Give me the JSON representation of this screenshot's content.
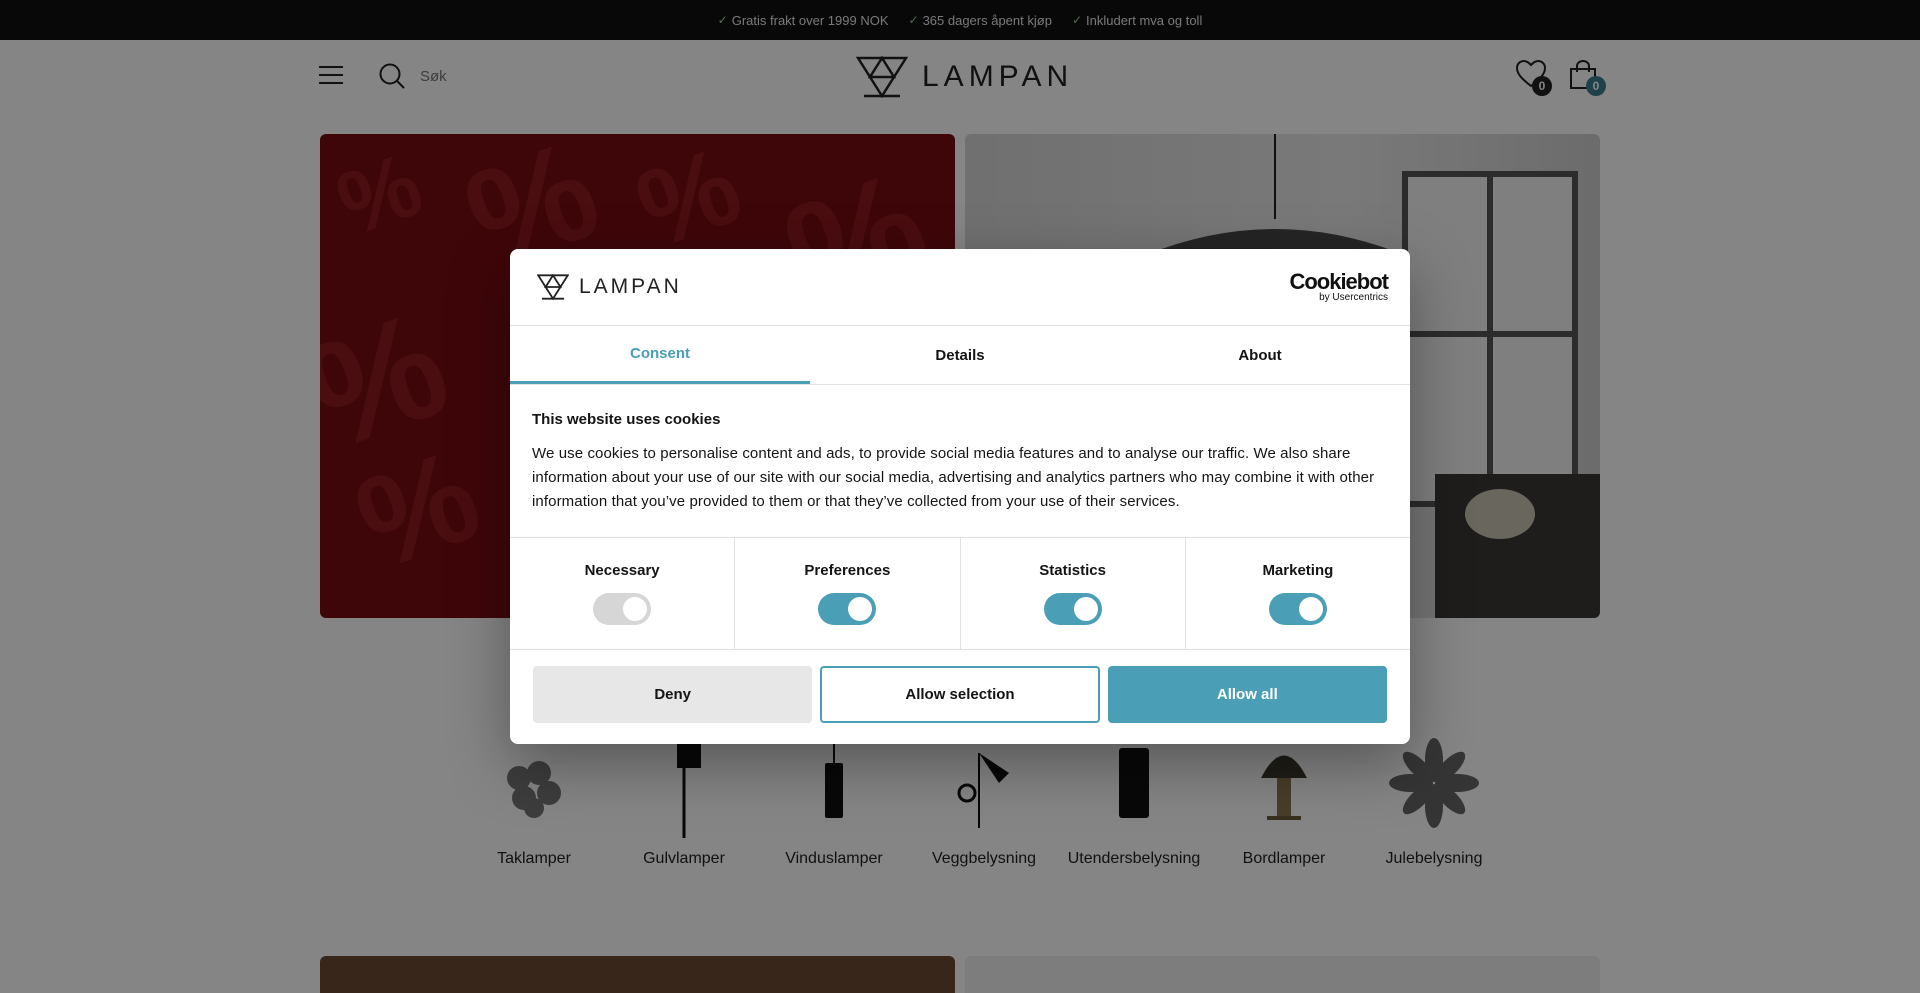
{
  "topbar": {
    "usps": [
      {
        "icon": "check-icon",
        "text": "Gratis frakt over 1999 NOK"
      },
      {
        "icon": "check-icon",
        "text": "365 dagers åpent kjøp"
      },
      {
        "icon": "check-icon",
        "text": "Inkludert mva og toll"
      }
    ]
  },
  "header": {
    "search_placeholder": "Søk",
    "logo_text": "LAMPAN",
    "wishlist_count": "0",
    "cart_count": "0"
  },
  "categories": [
    {
      "label": "Taklamper"
    },
    {
      "label": "Gulvlamper"
    },
    {
      "label": "Vinduslamper"
    },
    {
      "label": "Veggbelysning"
    },
    {
      "label": "Utendersbelysning"
    },
    {
      "label": "Bordlamper"
    },
    {
      "label": "Julebelysning"
    }
  ],
  "cookie_dialog": {
    "logo_text": "LAMPAN",
    "cookiebot_main": "Cookiebot",
    "cookiebot_sub": "by Usercentrics",
    "tabs": [
      {
        "label": "Consent",
        "active": true
      },
      {
        "label": "Details",
        "active": false
      },
      {
        "label": "About",
        "active": false
      }
    ],
    "title": "This website uses cookies",
    "text": "We use cookies to personalise content and ads, to provide social media features and to analyse our traffic. We also share information about your use of our site with our social media, advertising and analytics partners who may combine it with other information that you’ve provided to them or that they’ve collected from your use of their services.",
    "toggles": [
      {
        "label": "Necessary",
        "state": "on-disabled"
      },
      {
        "label": "Preferences",
        "state": "on"
      },
      {
        "label": "Statistics",
        "state": "on"
      },
      {
        "label": "Marketing",
        "state": "on"
      }
    ],
    "buttons": {
      "deny": "Deny",
      "allow_selection": "Allow selection",
      "allow_all": "Allow all"
    }
  },
  "colors": {
    "accent": "#4a9fb6",
    "topbar_bg": "#111111",
    "hero_red": "#7a0c12"
  }
}
